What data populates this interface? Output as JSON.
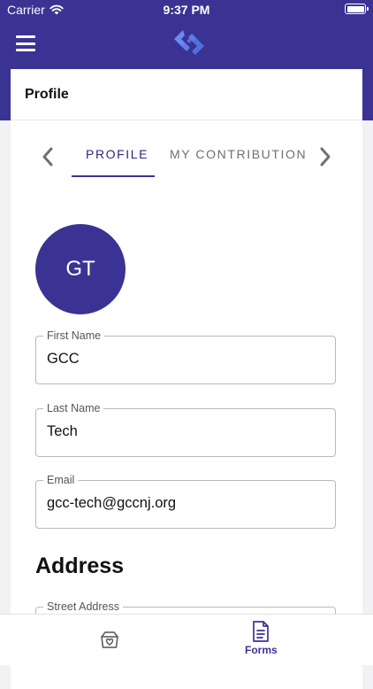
{
  "status_bar": {
    "carrier": "Carrier",
    "time": "9:37 PM"
  },
  "header": {
    "title": "Profile"
  },
  "tabs": [
    {
      "label": "PROFILE",
      "active": true
    },
    {
      "label": "MY CONTRIBUTION",
      "active": false
    }
  ],
  "profile": {
    "initials": "GT",
    "fields": {
      "first_name": {
        "label": "First Name",
        "value": "GCC"
      },
      "last_name": {
        "label": "Last Name",
        "value": "Tech"
      },
      "email": {
        "label": "Email",
        "value": "gcc-tech@gccnj.org"
      }
    },
    "address": {
      "title": "Address",
      "street": {
        "label": "Street Address",
        "value": ""
      }
    }
  },
  "bottom_nav": {
    "forms": {
      "label": "Forms"
    }
  },
  "colors": {
    "brand": "#3a3393",
    "brand_light": "#5b7ee8",
    "text_dark": "#111111",
    "muted": "#6f6f74"
  }
}
